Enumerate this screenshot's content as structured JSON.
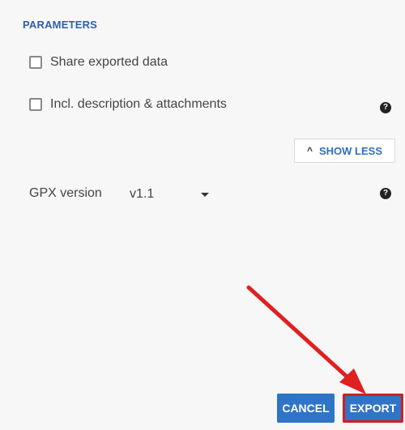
{
  "section": {
    "title": "PARAMETERS"
  },
  "options": {
    "share": {
      "label": "Share exported data",
      "checked": false
    },
    "incl": {
      "label": "Incl. description & attachments",
      "checked": false
    }
  },
  "toggle": {
    "label": "SHOW LESS",
    "icon": "chevron-up"
  },
  "gpx": {
    "label": "GPX version",
    "value": "v1.1"
  },
  "help_icon": {
    "glyph": "?"
  },
  "buttons": {
    "cancel": "CANCEL",
    "export": "EXPORT"
  },
  "colors": {
    "accent": "#2f74c7",
    "title": "#2f5fa8",
    "annotation": "#e02020"
  }
}
